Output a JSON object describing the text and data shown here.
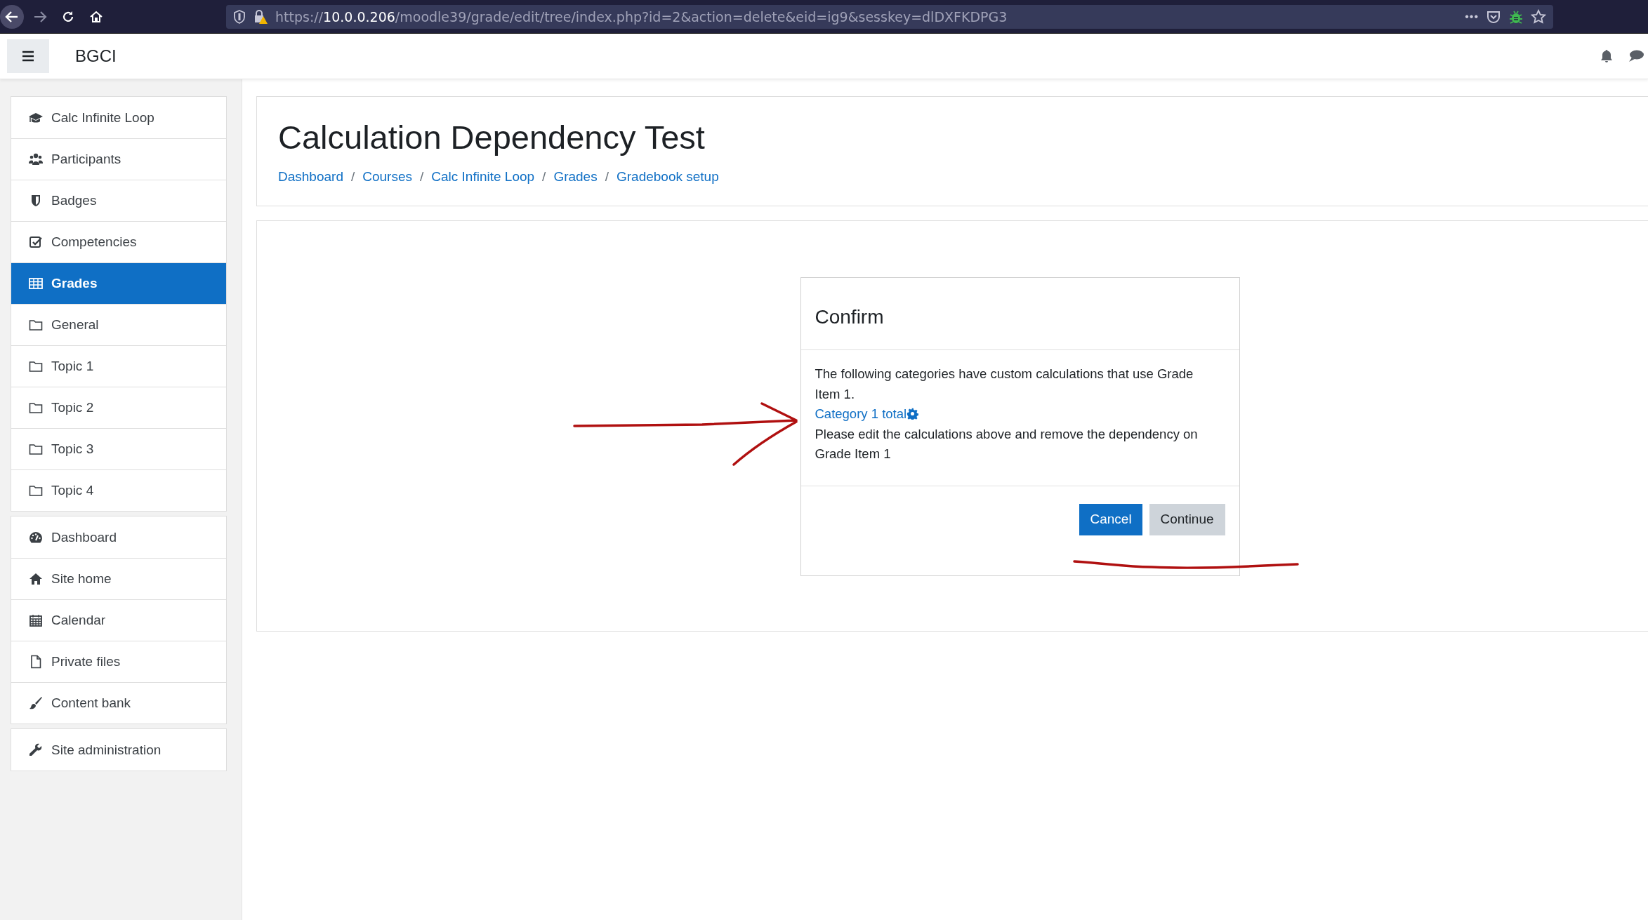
{
  "browser": {
    "url": {
      "scheme": "https://",
      "host": "10.0.0.206",
      "path": "/moodle39/grade/edit/tree/index.php?id=2&action=delete&eid=ig9&sesskey=dlDXFKDPG3"
    },
    "overflow_menu": "•••"
  },
  "navbar": {
    "site_name": "BGCI"
  },
  "sidebar": {
    "groups": [
      [
        {
          "label": "Calc Infinite Loop",
          "selected": false
        },
        {
          "label": "Participants",
          "selected": false
        },
        {
          "label": "Badges",
          "selected": false
        },
        {
          "label": "Competencies",
          "selected": false
        },
        {
          "label": "Grades",
          "selected": true
        },
        {
          "label": "General",
          "selected": false
        },
        {
          "label": "Topic 1",
          "selected": false
        },
        {
          "label": "Topic 2",
          "selected": false
        },
        {
          "label": "Topic 3",
          "selected": false
        },
        {
          "label": "Topic 4",
          "selected": false
        }
      ],
      [
        {
          "label": "Dashboard",
          "selected": false
        },
        {
          "label": "Site home",
          "selected": false
        },
        {
          "label": "Calendar",
          "selected": false
        },
        {
          "label": "Private files",
          "selected": false
        },
        {
          "label": "Content bank",
          "selected": false
        }
      ],
      [
        {
          "label": "Site administration",
          "selected": false
        }
      ]
    ]
  },
  "page_header": {
    "title": "Calculation Dependency Test",
    "breadcrumb": [
      "Dashboard",
      "Courses",
      "Calc Infinite Loop",
      "Grades",
      "Gradebook setup"
    ],
    "separator": "/"
  },
  "dialog": {
    "title": "Confirm",
    "message": "The following categories have custom calculations that use Grade Item 1.",
    "link": "Category 1 total",
    "instruction": "Please edit the calculations above and remove the dependency on Grade Item 1",
    "buttons": [
      {
        "label": "Cancel",
        "kind": "primary"
      },
      {
        "label": "Continue",
        "kind": "secondary"
      }
    ]
  }
}
